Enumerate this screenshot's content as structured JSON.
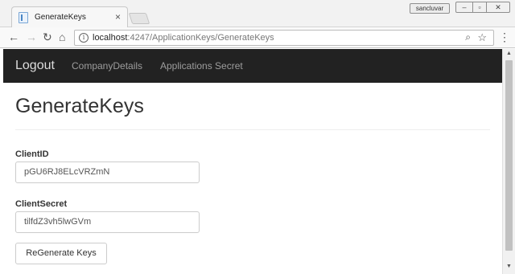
{
  "browser": {
    "tab_title": "GenerateKeys",
    "tab_close": "×",
    "user_badge": "sancluvar",
    "url_host": "localhost",
    "url_rest": ":4247/ApplicationKeys/GenerateKeys",
    "icons": {
      "back": "back-arrow-icon",
      "forward": "forward-arrow-icon",
      "reload": "reload-icon",
      "home": "home-icon",
      "info": "info-icon",
      "zoom": "zoom-icon",
      "bookmark": "star-icon",
      "menu": "menu-icon"
    }
  },
  "navbar": {
    "brand": "Logout",
    "links": [
      "CompanyDetails",
      "Applications Secret"
    ],
    "background": "#222222"
  },
  "main": {
    "title": "GenerateKeys",
    "client_id_label": "ClientID",
    "client_id_value": "pGU6RJ8ELcVRZmN",
    "client_secret_label": "ClientSecret",
    "client_secret_value": "tilfdZ3vh5lwGVm",
    "regenerate_label": "ReGenerate Keys"
  }
}
